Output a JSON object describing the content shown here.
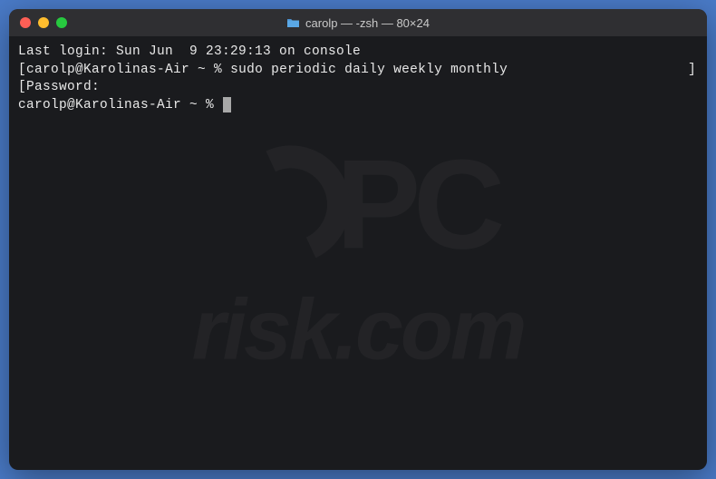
{
  "window": {
    "title": "carolp — -zsh — 80×24"
  },
  "terminal": {
    "line1": "Last login: Sun Jun  9 23:29:13 on console",
    "line2_bracket": "[",
    "line2_prompt": "carolp@Karolinas-Air ~ % ",
    "line2_command": "sudo periodic daily weekly monthly",
    "line2_bracket_right": "]",
    "line3_bracket": "[",
    "line3_text": "Password:",
    "line4_prompt": "carolp@Karolinas-Air ~ % "
  },
  "watermark": {
    "logo_text": "PC",
    "domain_text": "risk.com"
  }
}
